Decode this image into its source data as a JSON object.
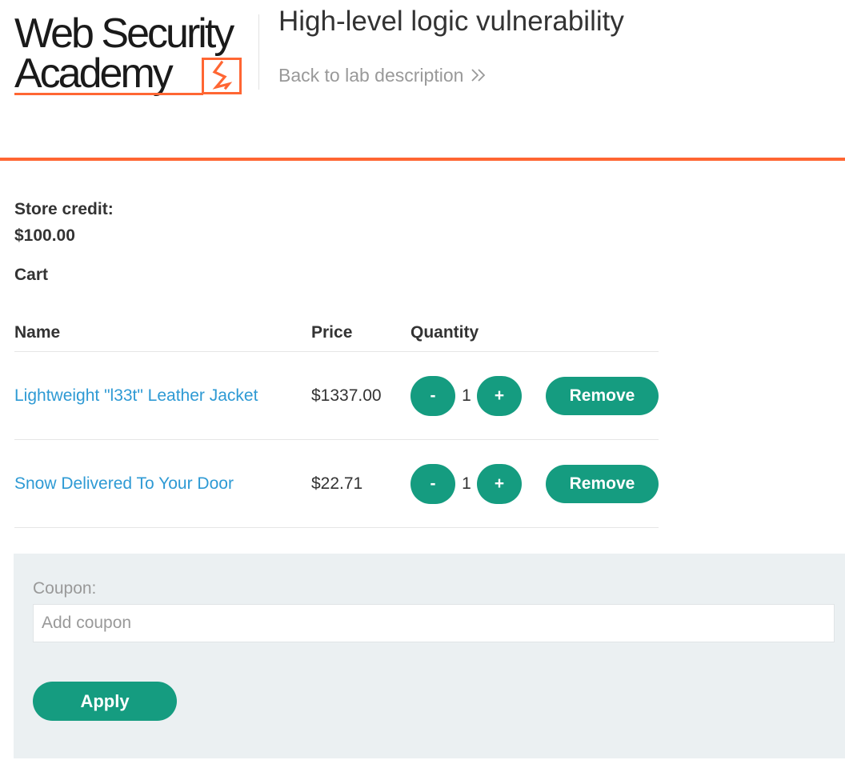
{
  "header": {
    "logo_line1": "Web Security",
    "logo_line2": "Academy",
    "lab_title": "High-level logic vulnerability",
    "back_link": "Back to lab description",
    "brand_color": "#ff6633"
  },
  "account": {
    "store_credit_label": "Store credit:",
    "store_credit_value": "$100.00"
  },
  "cart": {
    "heading": "Cart",
    "columns": {
      "name": "Name",
      "price": "Price",
      "quantity": "Quantity"
    },
    "items": [
      {
        "name": "Lightweight \"l33t\" Leather Jacket",
        "price": "$1337.00",
        "quantity": "1",
        "minus_label": "-",
        "plus_label": "+",
        "remove_label": "Remove"
      },
      {
        "name": "Snow Delivered To Your Door",
        "price": "$22.71",
        "quantity": "1",
        "minus_label": "-",
        "plus_label": "+",
        "remove_label": "Remove"
      }
    ]
  },
  "coupon": {
    "label": "Coupon:",
    "placeholder": "Add coupon",
    "value": "",
    "apply_label": "Apply"
  },
  "colors": {
    "accent": "#ff6633",
    "button": "#159c80",
    "link": "#2e9ad4",
    "panel": "#ebf0f2"
  },
  "icons": {
    "logo_mark": "lightning-bolt-icon",
    "back_chevron": "double-chevron-right-icon"
  }
}
